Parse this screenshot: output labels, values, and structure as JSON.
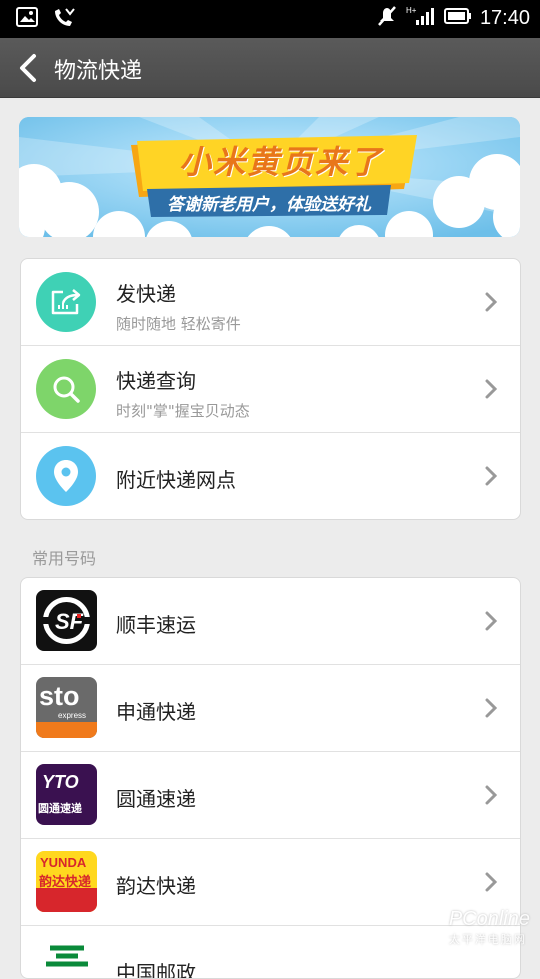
{
  "status_bar": {
    "time": "17:40",
    "icons": [
      "gallery-icon",
      "phone-missed-icon",
      "muted-icon",
      "signal-icon",
      "battery-icon"
    ]
  },
  "header": {
    "title": "物流快递"
  },
  "banner": {
    "headline": "小米黄页来了",
    "subline": "答谢新老用户，体验送好礼"
  },
  "services": [
    {
      "title": "发快递",
      "subtitle": "随时随地 轻松寄件",
      "icon": "send-package-icon",
      "color": "#3fd1b5"
    },
    {
      "title": "快递查询",
      "subtitle": "时刻\"掌\"握宝贝动态",
      "icon": "search-icon",
      "color": "#7ed56a"
    },
    {
      "title": "附近快递网点",
      "icon": "location-pin-icon",
      "color": "#5bc3ef"
    }
  ],
  "common_numbers": {
    "label": "常用号码",
    "items": [
      {
        "name": "顺丰速运",
        "logo": "sf-logo"
      },
      {
        "name": "申通快递",
        "logo": "sto-logo",
        "logo_text": "sto",
        "logo_sub": "express"
      },
      {
        "name": "圆通速递",
        "logo": "yto-logo",
        "logo_text": "YTO",
        "logo_sub": "圆通速递"
      },
      {
        "name": "韵达快递",
        "logo": "yunda-logo",
        "logo_text": "YUNDA",
        "logo_sub": "韵达快递"
      },
      {
        "name": "中国邮政",
        "logo": "china-post-logo"
      }
    ]
  },
  "watermark": {
    "text": "PConline",
    "sub": "太平洋电脑网"
  }
}
